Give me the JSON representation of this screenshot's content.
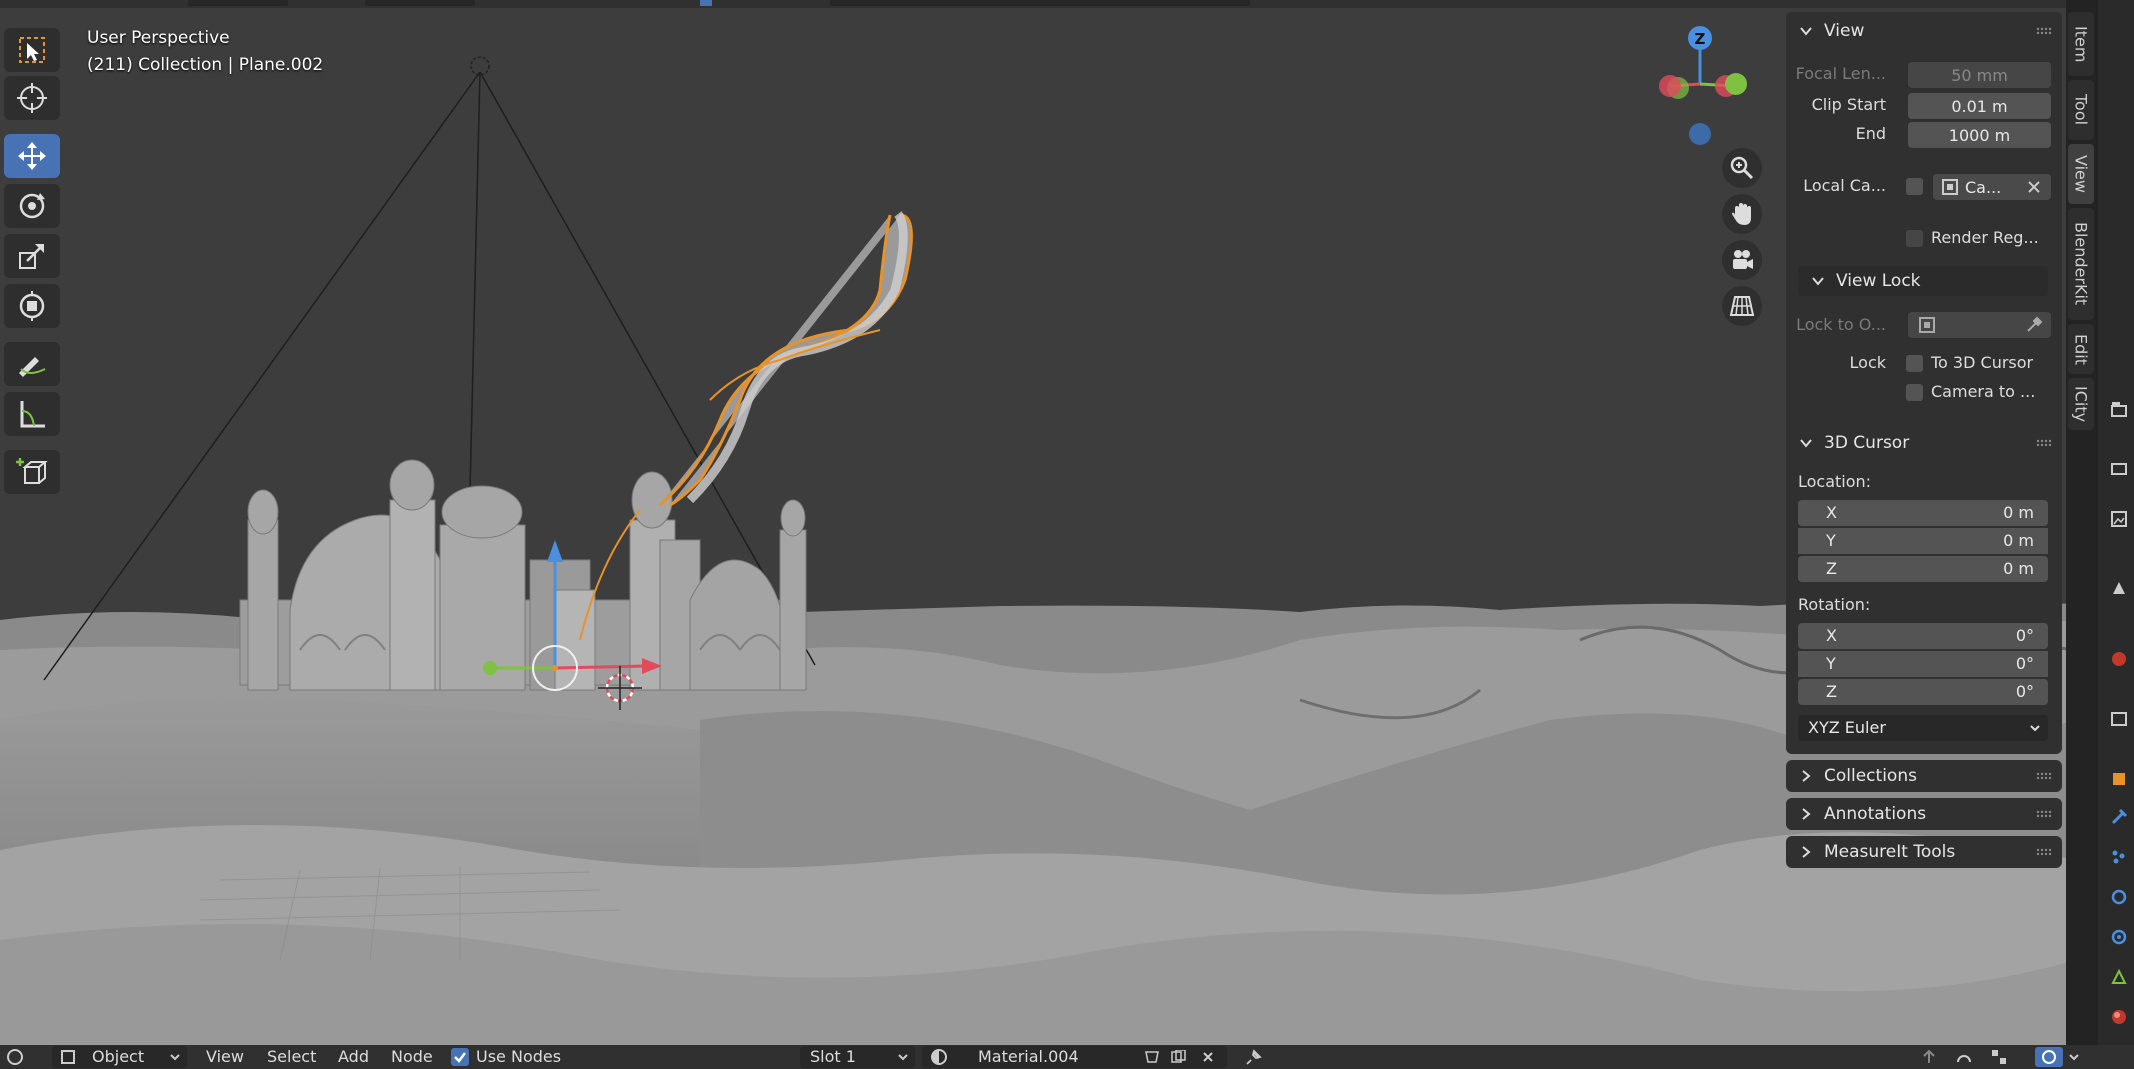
{
  "viewport": {
    "mode": "User Perspective",
    "object_info": "(211) Collection | Plane.002"
  },
  "toolbar": {
    "tools": [
      {
        "name": "select-box-icon"
      },
      {
        "name": "cursor-icon"
      },
      {
        "name": "move-icon",
        "active": true
      },
      {
        "name": "rotate-icon"
      },
      {
        "name": "scale-icon"
      },
      {
        "name": "transform-icon"
      },
      {
        "name": "annotate-icon"
      },
      {
        "name": "measure-icon"
      },
      {
        "name": "add-cube-icon"
      }
    ]
  },
  "gizmo": {
    "z": "Z"
  },
  "view_panel": {
    "title": "View",
    "focal_label": "Focal Len...",
    "focal_value": "50 mm",
    "clip_start_label": "Clip Start",
    "clip_start_value": "0.01 m",
    "clip_end_label": "End",
    "clip_end_value": "1000 m",
    "local_camera_label": "Local Ca...",
    "local_camera_value": "Ca...",
    "render_region": "Render Reg...",
    "view_lock_title": "View Lock",
    "lock_to_object_label": "Lock to O...",
    "lock_label": "Lock",
    "to_3d_cursor": "To 3D Cursor",
    "camera_to": "Camera to ..."
  },
  "cursor_panel": {
    "title": "3D Cursor",
    "location_label": "Location:",
    "location": [
      {
        "axis": "X",
        "value": "0 m"
      },
      {
        "axis": "Y",
        "value": "0 m"
      },
      {
        "axis": "Z",
        "value": "0 m"
      }
    ],
    "rotation_label": "Rotation:",
    "rotation": [
      {
        "axis": "X",
        "value": "0°"
      },
      {
        "axis": "Y",
        "value": "0°"
      },
      {
        "axis": "Z",
        "value": "0°"
      }
    ],
    "rotation_mode": "XYZ Euler"
  },
  "collapsed_panels": [
    "Collections",
    "Annotations",
    "MeasureIt Tools"
  ],
  "side_tabs": [
    "Item",
    "Tool",
    "View",
    "BlenderKit",
    "Edit",
    "ICity"
  ],
  "header": {
    "mode": "Object",
    "menus": [
      "View",
      "Select",
      "Add",
      "Node"
    ],
    "use_nodes": "Use Nodes",
    "slot": "Slot 1",
    "material": "Material.004"
  },
  "colors": {
    "viewport_bg": "#3d3d3d",
    "panel_bg": "#303030",
    "accent": "#4772b3",
    "selection": "#e8922a",
    "axis_x": "#e24a5e",
    "axis_y": "#7fc241",
    "axis_z": "#4a8fe0"
  }
}
